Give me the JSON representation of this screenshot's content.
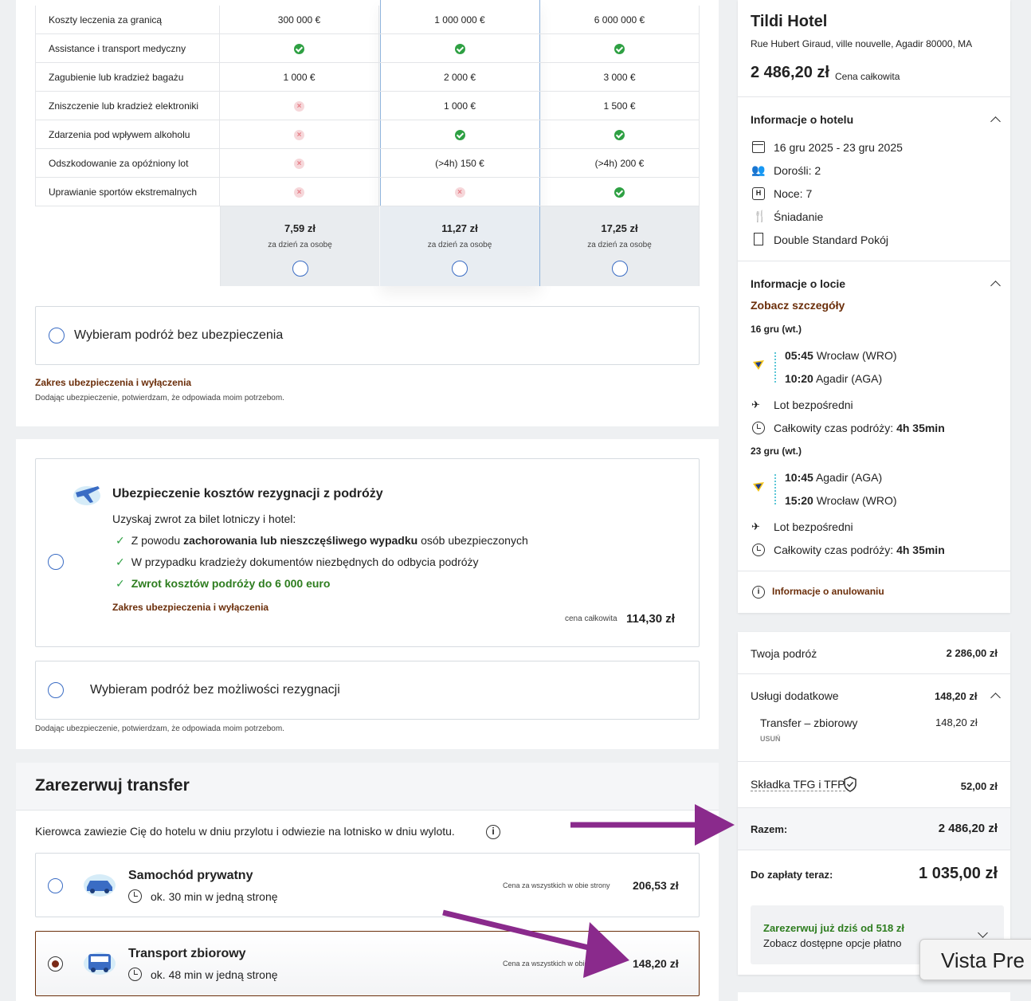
{
  "coverage": {
    "rows": [
      {
        "label": "Koszty leczenia za granicą",
        "c1": "300 000 €",
        "c2": "1 000 000 €",
        "c3": "6 000 000 €"
      },
      {
        "label": "Assistance i transport medyczny",
        "c1": "check",
        "c2": "check",
        "c3": "check"
      },
      {
        "label": "Zagubienie lub kradzież bagażu",
        "c1": "1 000 €",
        "c2": "2 000 €",
        "c3": "3 000 €"
      },
      {
        "label": "Zniszczenie lub kradzież elektroniki",
        "c1": "cross",
        "c2": "1 000 €",
        "c3": "1 500 €"
      },
      {
        "label": "Zdarzenia pod wpływem alkoholu",
        "c1": "cross",
        "c2": "check",
        "c3": "check"
      },
      {
        "label": "Odszkodowanie za opóźniony lot",
        "c1": "cross",
        "c2": "(>4h) 150 €",
        "c3": "(>4h) 200 €"
      },
      {
        "label": "Uprawianie sportów ekstremalnych",
        "c1": "cross",
        "c2": "cross",
        "c3": "check"
      }
    ],
    "prices": [
      {
        "price": "7,59 zł",
        "sub": "za dzień za osobę"
      },
      {
        "price": "11,27 zł",
        "sub": "za dzień za osobę"
      },
      {
        "price": "17,25 zł",
        "sub": "za dzień za osobę"
      }
    ],
    "no_insurance": "Wybieram podróż bez ubezpieczenia",
    "scope_link": "Zakres ubezpieczenia i wyłączenia",
    "consent": "Dodając ubezpieczenie, potwierdzam, że odpowiada moim potrzebom."
  },
  "cancellation": {
    "title": "Ubezpieczenie kosztów rezygnacji z podróży",
    "intro": "Uzyskaj zwrot za bilet lotniczy i hotel:",
    "b1_pre": "Z powodu ",
    "b1_bold": "zachorowania lub nieszczęśliwego wypadku",
    "b1_post": " osób ubezpieczonych",
    "b2": "W przypadku kradzieży dokumentów niezbędnych do odbycia podróży",
    "b3": "Zwrot kosztów podróży do 6 000 euro",
    "scope_link": "Zakres ubezpieczenia i wyłączenia",
    "price_label": "cena całkowita",
    "price": "114,30 zł",
    "no_option": "Wybieram podróż bez możliwości rezygnacji",
    "consent": "Dodając ubezpieczenie, potwierdzam, że odpowiada moim potrzebom."
  },
  "transfer": {
    "title": "Zarezerwuj transfer",
    "desc": "Kierowca zawiezie Cię do hotelu w dniu przylotu i odwiezie na lotnisko w dniu wylotu.",
    "options": [
      {
        "name": "Samochód prywatny",
        "time": "ok. 30 min w jedną stronę",
        "price_label": "Cena za wszystkich w obie strony",
        "price": "206,53 zł"
      },
      {
        "name": "Transport zbiorowy",
        "time": "ok. 48 min w jedną stronę",
        "price_label": "Cena za wszystkich w obie strony",
        "price": "148,20 zł"
      }
    ]
  },
  "hotel": {
    "name": "Tildi Hotel",
    "address": "Rue Hubert Giraud, ville nouvelle, Agadir 80000, MA",
    "total_price": "2 486,20 zł",
    "total_label": "Cena całkowita",
    "info_title": "Informacje o hotelu",
    "dates": "16 gru 2025 - 23 gru 2025",
    "adults": "Dorośli: 2",
    "nights": "Noce: 7",
    "board": "Śniadanie",
    "room": "Double Standard Pokój"
  },
  "flight": {
    "title": "Informacje o locie",
    "details_link": "Zobacz szczegóły",
    "out_date": "16 gru (wt.)",
    "out_dep_time": "05:45",
    "out_dep": "Wrocław (WRO)",
    "out_arr_time": "10:20",
    "out_arr": "Agadir (AGA)",
    "direct": "Lot bezpośredni",
    "duration_label": "Całkowity czas podróży:",
    "duration": "4h 35min",
    "ret_date": "23 gru (wt.)",
    "ret_dep_time": "10:45",
    "ret_dep": "Agadir (AGA)",
    "ret_arr_time": "15:20",
    "ret_arr": "Wrocław (WRO)",
    "cancel_info": "Informacje o anulowaniu"
  },
  "summary": {
    "trip_label": "Twoja podróż",
    "trip_value": "2 286,00 zł",
    "extras_label": "Usługi dodatkowe",
    "extras_value": "148,20 zł",
    "transfer_label": "Transfer – zbiorowy",
    "transfer_value": "148,20 zł",
    "remove": "USUŃ",
    "tfg_label": "Składka TFG i TFP",
    "tfg_value": "52,00 zł",
    "total_label": "Razem:",
    "total_value": "2 486,20 zł",
    "pay_label": "Do zapłaty teraz:",
    "pay_value": "1 035,00 zł",
    "promo_title": "Zarezerwuj już dziś od 518 zł",
    "promo_sub": "Zobacz dostępne opcje płatno",
    "tooltip": "Vista Pre"
  },
  "colors": {
    "annotation_arrow": "#8a2a8c",
    "brand_brown": "#6b2e0a",
    "green": "#2e7d1f",
    "radio_blue": "#3a6cc4"
  }
}
